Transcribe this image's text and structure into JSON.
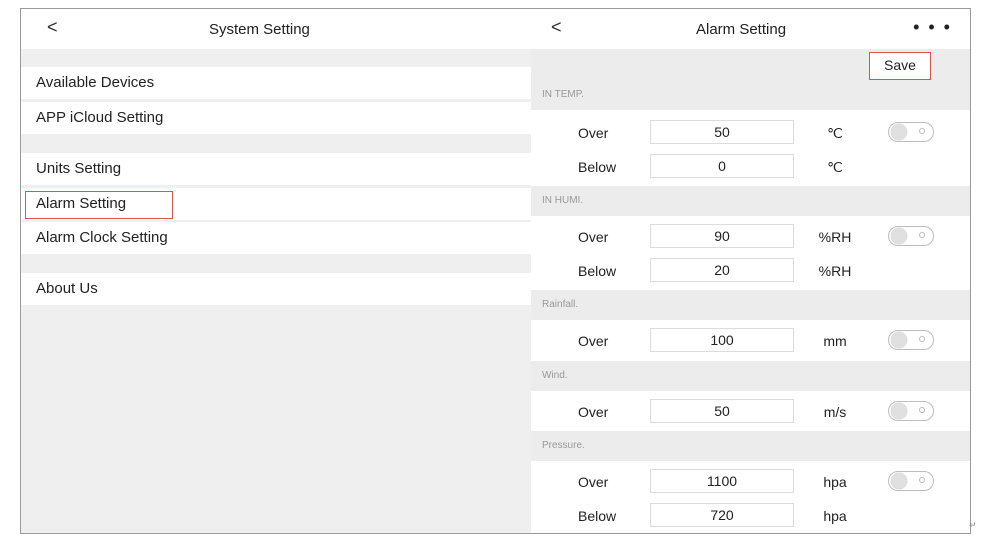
{
  "left_panel": {
    "back_icon": "<",
    "title": "System Setting",
    "menu_items": [
      {
        "label": "Available Devices"
      },
      {
        "label": "APP iCloud Setting"
      },
      {
        "label": "Units Setting"
      },
      {
        "label": "Alarm Setting"
      },
      {
        "label": "Alarm Clock Setting"
      },
      {
        "label": "About Us"
      }
    ]
  },
  "right_panel": {
    "back_icon": "<",
    "title": "Alarm Setting",
    "more_icon": "• • •",
    "save_label": "Save",
    "sections": [
      {
        "header": "IN TEMP.",
        "rows": [
          {
            "label": "Over",
            "value": "50",
            "unit": "℃",
            "toggle": "off"
          },
          {
            "label": "Below",
            "value": "0",
            "unit": "℃"
          }
        ]
      },
      {
        "header": "IN HUMI.",
        "rows": [
          {
            "label": "Over",
            "value": "90",
            "unit": "%RH",
            "toggle": "off"
          },
          {
            "label": "Below",
            "value": "20",
            "unit": "%RH"
          }
        ]
      },
      {
        "header": "Rainfall.",
        "rows": [
          {
            "label": "Over",
            "value": "100",
            "unit": "mm",
            "toggle": "off"
          }
        ]
      },
      {
        "header": "Wind.",
        "rows": [
          {
            "label": "Over",
            "value": "50",
            "unit": "m/s",
            "toggle": "off"
          }
        ]
      },
      {
        "header": "Pressure.",
        "rows": [
          {
            "label": "Over",
            "value": "1100",
            "unit": "hpa",
            "toggle": "off"
          },
          {
            "label": "Below",
            "value": "720",
            "unit": "hpa"
          }
        ]
      }
    ]
  },
  "colors": {
    "highlight": "#d9534f",
    "section_bg": "#ececec",
    "panel_bg": "#efefef"
  },
  "return_mark": "↵"
}
